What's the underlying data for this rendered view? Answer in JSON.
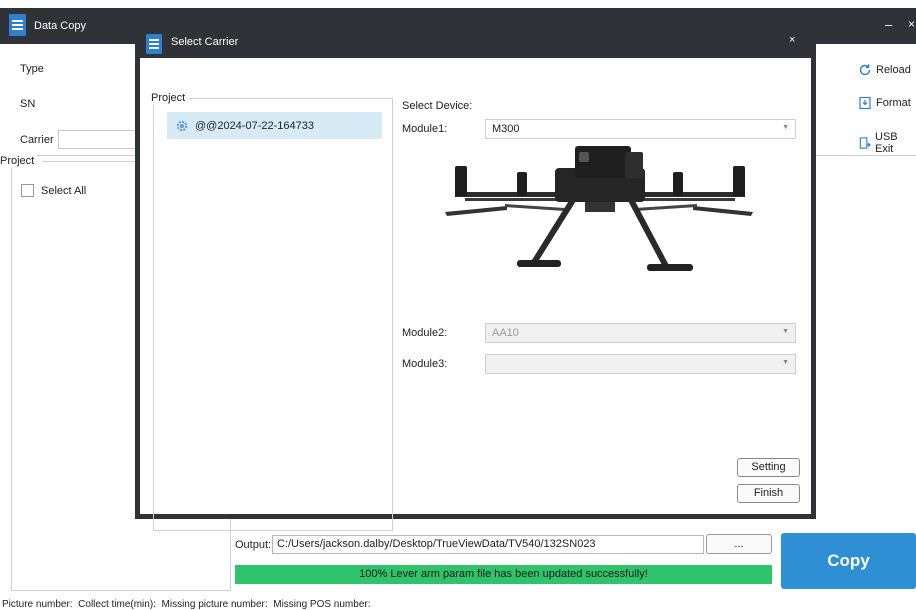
{
  "main_window": {
    "title": "Data Copy",
    "minimize_symbol": "–",
    "close_symbol": "×",
    "form": {
      "type_label": "Type",
      "sn_label": "SN",
      "carrier_label": "Carrier",
      "carrier_value": ""
    },
    "project_group": {
      "label": "Project",
      "select_all_label": "Select All",
      "select_all_checked": false
    },
    "actions": {
      "reload_label": "Reload",
      "format_label": "Format",
      "usb_exit_label": "USB Exit"
    },
    "output": {
      "label": "Output:",
      "path": "C:/Users/jackson.dalby/Desktop/TrueViewData/TV540/132SN023",
      "browse_label": "..."
    },
    "progress": {
      "percent": 100,
      "message": "100% Lever arm param file has been updated successfully!",
      "color": "#2fc46b"
    },
    "copy_button_label": "Copy",
    "footer": {
      "picture_number": "Picture number:",
      "collect_time": "Collect time(min):",
      "missing_picture": "Missing picture number:",
      "missing_pos": "Missing POS number:"
    }
  },
  "dialog": {
    "title": "Select Carrier",
    "close_symbol": "×",
    "project_label": "Project",
    "projects": [
      {
        "name": "@@2024-07-22-164733",
        "icon": "gear-icon",
        "selected": true
      }
    ],
    "select_device_label": "Select Device:",
    "module1": {
      "label": "Module1:",
      "value": "M300",
      "enabled": true
    },
    "module2": {
      "label": "Module2:",
      "value": "AA10",
      "enabled": false
    },
    "module3": {
      "label": "Module3:",
      "value": "",
      "enabled": false
    },
    "setting_label": "Setting",
    "finish_label": "Finish"
  },
  "colors": {
    "titlebar": "#2f3237",
    "accent_blue": "#2e8fd4",
    "selection": "#d7ebf6",
    "progress_green": "#2fc46b"
  }
}
